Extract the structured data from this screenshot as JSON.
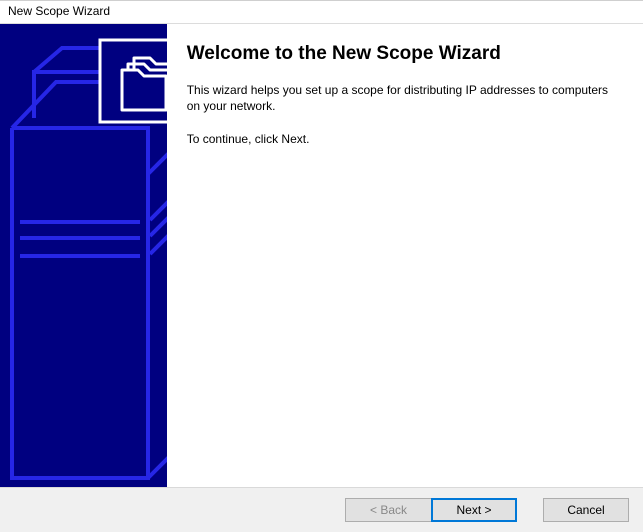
{
  "window": {
    "title": "New Scope Wizard"
  },
  "wizard": {
    "heading": "Welcome to the New Scope Wizard",
    "intro": "This wizard helps you set up a scope for distributing IP addresses to computers on your network.",
    "continue_hint": "To continue, click Next."
  },
  "buttons": {
    "back": "< Back",
    "next": "Next >",
    "cancel": "Cancel"
  },
  "art": {
    "icon_name": "folders-icon",
    "bg_color": "#000080",
    "accent_color": "#1a1aff"
  }
}
